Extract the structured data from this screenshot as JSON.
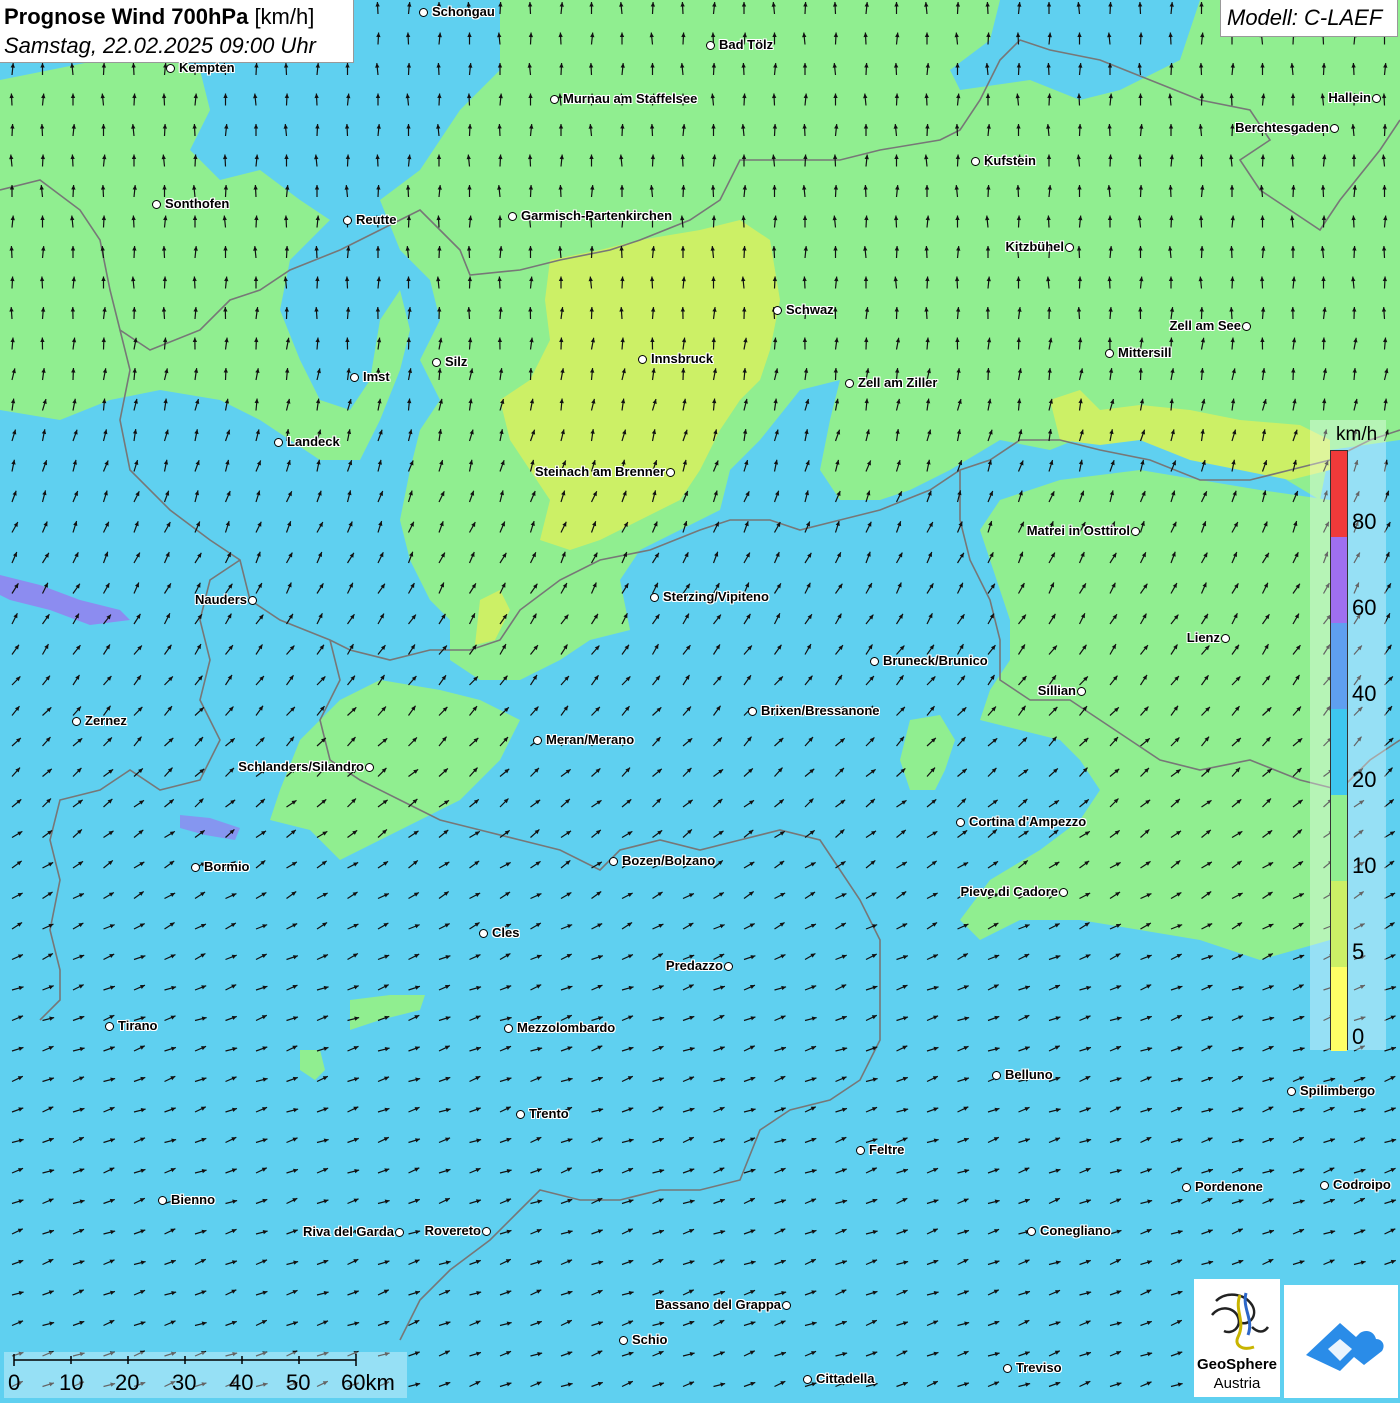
{
  "header": {
    "title_bold": "Prognose Wind 700hPa",
    "title_unit": "[km/h]",
    "datetime": "Samstag, 22.02.2025 09:00 Uhr",
    "model": "Modell: C-LAEF"
  },
  "colors": {
    "calm_yellow": "#ffff66",
    "yellow_green": "#ccf066",
    "light_green": "#90ee90",
    "cyan": "#5fd0f0",
    "blue": "#5f9ff0",
    "purple": "#9f6ff0",
    "red": "#f03a3a",
    "border_gray": "#777777",
    "arrow_black": "#111111"
  },
  "legend": {
    "unit": "km/h",
    "ticks": [
      "80",
      "60",
      "40",
      "20",
      "10",
      "5",
      "0"
    ]
  },
  "scalebar": {
    "labels": [
      "0",
      "10",
      "20",
      "30",
      "40",
      "50",
      "60km"
    ]
  },
  "logo": {
    "line1": "GeoSphere",
    "line2": "Austria"
  },
  "cities": [
    {
      "name": "Schongau",
      "side": "right"
    },
    {
      "name": "Bad Tölz",
      "side": "right"
    },
    {
      "name": "Kempten",
      "side": "right"
    },
    {
      "name": "Murnau am Staffelsee",
      "side": "right"
    },
    {
      "name": "Hallein",
      "side": "left"
    },
    {
      "name": "Berchtesgaden",
      "side": "left"
    },
    {
      "name": "Kufstein",
      "side": "right"
    },
    {
      "name": "Sonthofen",
      "side": "right"
    },
    {
      "name": "Reutte",
      "side": "right"
    },
    {
      "name": "Garmisch-Partenkirchen",
      "side": "right"
    },
    {
      "name": "Kitzbühel",
      "side": "left"
    },
    {
      "name": "Schwaz",
      "side": "right"
    },
    {
      "name": "Zell am See",
      "side": "left"
    },
    {
      "name": "Mittersill",
      "side": "right"
    },
    {
      "name": "Innsbruck",
      "side": "right"
    },
    {
      "name": "Imst",
      "side": "right"
    },
    {
      "name": "Silz",
      "side": "right"
    },
    {
      "name": "Zell am Ziller",
      "side": "right"
    },
    {
      "name": "Landeck",
      "side": "right"
    },
    {
      "name": "Steinach am Brenner",
      "side": "left"
    },
    {
      "name": "Matrei in Osttirol",
      "side": "left"
    },
    {
      "name": "Nauders",
      "side": "left"
    },
    {
      "name": "Sterzing/Vipiteno",
      "side": "right"
    },
    {
      "name": "Lienz",
      "side": "left"
    },
    {
      "name": "Bruneck/Brunico",
      "side": "right"
    },
    {
      "name": "Sillian",
      "side": "left"
    },
    {
      "name": "Zernez",
      "side": "right"
    },
    {
      "name": "Brixen/Bressanone",
      "side": "right"
    },
    {
      "name": "Meran/Merano",
      "side": "right"
    },
    {
      "name": "Schlanders/Silandro",
      "side": "left"
    },
    {
      "name": "Cortina d'Ampezzo",
      "side": "right"
    },
    {
      "name": "Bozen/Bolzano",
      "side": "right"
    },
    {
      "name": "Bormio",
      "side": "right"
    },
    {
      "name": "Pieve di Cadore",
      "side": "left"
    },
    {
      "name": "Cles",
      "side": "right"
    },
    {
      "name": "Predazzo",
      "side": "left"
    },
    {
      "name": "Tirano",
      "side": "right"
    },
    {
      "name": "Mezzolombardo",
      "side": "right"
    },
    {
      "name": "Belluno",
      "side": "right"
    },
    {
      "name": "Spilimbergo",
      "side": "right"
    },
    {
      "name": "Trento",
      "side": "right"
    },
    {
      "name": "Feltre",
      "side": "right"
    },
    {
      "name": "Pordenone",
      "side": "right"
    },
    {
      "name": "Codroipo",
      "side": "right"
    },
    {
      "name": "Bienno",
      "side": "right"
    },
    {
      "name": "Riva del Garda",
      "side": "left"
    },
    {
      "name": "Rovereto",
      "side": "left"
    },
    {
      "name": "Conegliano",
      "side": "right"
    },
    {
      "name": "Bassano del Grappa",
      "side": "left"
    },
    {
      "name": "Schio",
      "side": "right"
    },
    {
      "name": "Treviso",
      "side": "right"
    },
    {
      "name": "Cittadella",
      "side": "right"
    }
  ]
}
